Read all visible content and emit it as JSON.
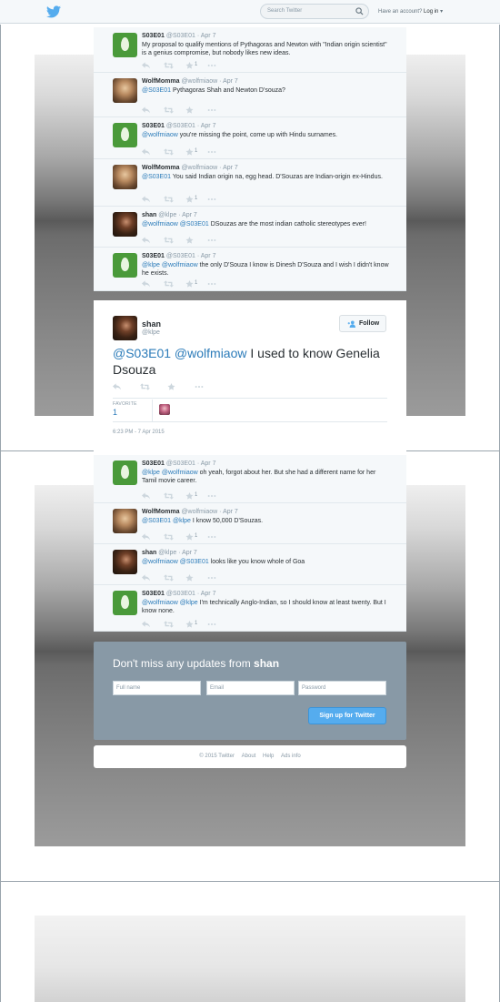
{
  "topbar": {
    "search_placeholder": "Search Twitter",
    "login_prompt": "Have an account?",
    "login_label": "Log in"
  },
  "replies_before": [
    {
      "name": "S03E01",
      "handle": "@S03E01",
      "date": "Apr 7",
      "avatar": "default-egg",
      "segments": [
        {
          "text": "My proposal to qualify mentions of Pythagoras and Newton with \"Indian origin scientist\" is a genius compromise, but nobody likes new ideas.",
          "mention": false
        }
      ],
      "favorites": "1"
    },
    {
      "name": "WolfMomma",
      "handle": "@wolfmiaow",
      "date": "Apr 7",
      "avatar": "wolfmomma-photo",
      "segments": [
        {
          "text": "@S03E01",
          "mention": true
        },
        {
          "text": " Pythagoras Shah and Newton D'souza?",
          "mention": false
        }
      ],
      "favorites": ""
    },
    {
      "name": "S03E01",
      "handle": "@S03E01",
      "date": "Apr 7",
      "avatar": "default-egg",
      "segments": [
        {
          "text": "@wolfmiaow",
          "mention": true
        },
        {
          "text": " you're missing the point, come up with Hindu surnames.",
          "mention": false
        }
      ],
      "favorites": "1"
    },
    {
      "name": "WolfMomma",
      "handle": "@wolfmiaow",
      "date": "Apr 7",
      "avatar": "wolfmomma-photo",
      "segments": [
        {
          "text": "@S03E01",
          "mention": true
        },
        {
          "text": " You said Indian origin na, egg head. D'Souzas are Indian-origin ex-Hindus.",
          "mention": false
        }
      ],
      "favorites": "1"
    },
    {
      "name": "shan",
      "handle": "@klpe",
      "date": "Apr 7",
      "avatar": "shan-photo",
      "segments": [
        {
          "text": "@wolfmiaow @S03E01",
          "mention": true
        },
        {
          "text": " DSouzas are the most indian catholic stereotypes ever!",
          "mention": false
        }
      ],
      "favorites": ""
    },
    {
      "name": "S03E01",
      "handle": "@S03E01",
      "date": "Apr 7",
      "avatar": "default-egg",
      "segments": [
        {
          "text": "@klpe @wolfmiaow",
          "mention": true
        },
        {
          "text": " the only D'Souza I know is Dinesh D'Souza and I wish I didn't know he exists.",
          "mention": false
        }
      ],
      "favorites": "1"
    }
  ],
  "main_tweet": {
    "name": "shan",
    "handle": "@klpe",
    "follow_label": "Follow",
    "segments": [
      {
        "text": "@S03E01 @wolfmiaow",
        "mention": true
      },
      {
        "text": " I used to know Genelia Dsouza",
        "mention": false
      }
    ],
    "favorite_label": "FAVORITE",
    "favorite_count": "1",
    "timestamp": "6:23 PM - 7 Apr 2015"
  },
  "replies_after": [
    {
      "name": "S03E01",
      "handle": "@S03E01",
      "date": "Apr 7",
      "avatar": "default-egg",
      "segments": [
        {
          "text": "@klpe @wolfmiaow",
          "mention": true
        },
        {
          "text": " oh yeah, forgot about her. But she had a different name for her Tamil movie career.",
          "mention": false
        }
      ],
      "favorites": "1"
    },
    {
      "name": "WolfMomma",
      "handle": "@wolfmiaow",
      "date": "Apr 7",
      "avatar": "wolfmomma-photo",
      "segments": [
        {
          "text": "@S03E01 @klpe",
          "mention": true
        },
        {
          "text": " I know 50,000 D'Souzas.",
          "mention": false
        }
      ],
      "favorites": "1"
    },
    {
      "name": "shan",
      "handle": "@klpe",
      "date": "Apr 7",
      "avatar": "shan-photo",
      "segments": [
        {
          "text": "@wolfmiaow @S03E01",
          "mention": true
        },
        {
          "text": " looks like you know whole of Goa",
          "mention": false
        }
      ],
      "favorites": ""
    },
    {
      "name": "S03E01",
      "handle": "@S03E01",
      "date": "Apr 7",
      "avatar": "default-egg",
      "segments": [
        {
          "text": "@wolfmiaow @klpe",
          "mention": true
        },
        {
          "text": " I'm technically Anglo-Indian, so I should know at least twenty. But I know none.",
          "mention": false
        }
      ],
      "favorites": "1"
    }
  ],
  "signup": {
    "title_prefix": "Don't miss any updates from",
    "title_user": "shan",
    "fullname_placeholder": "Full name",
    "email_placeholder": "Email",
    "password_placeholder": "Password",
    "button_label": "Sign up for Twitter"
  },
  "footer": {
    "copyright": "© 2015 Twitter",
    "links": [
      "About",
      "Help",
      "Ads info"
    ]
  },
  "colors": {
    "brand": "#55acee",
    "mention": "#2b7bb9",
    "egg": "#4a9a3a"
  }
}
